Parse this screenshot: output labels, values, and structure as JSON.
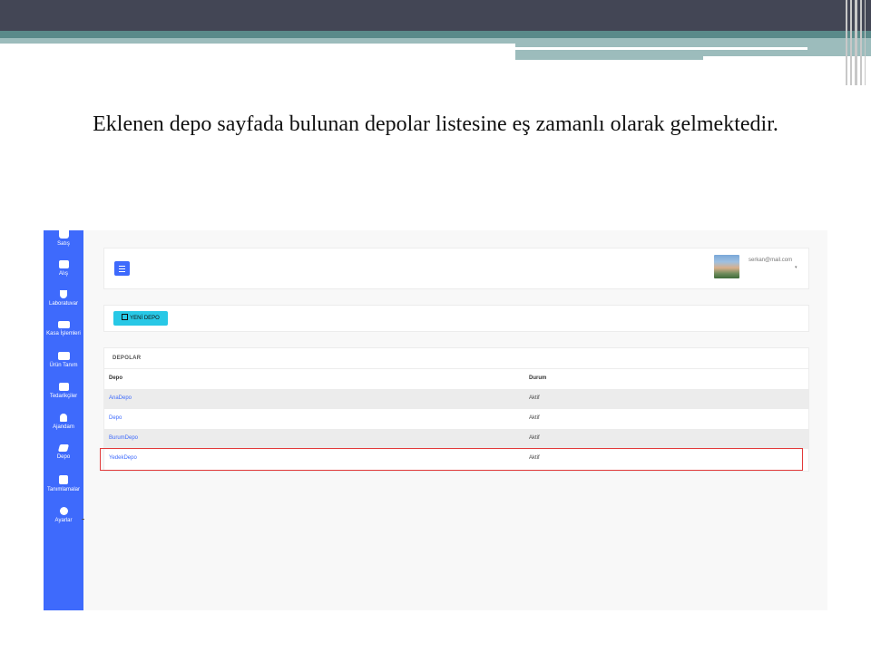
{
  "slide": {
    "text": "Eklenen depo sayfada bulunan depolar listesine eş zamanlı olarak gelmektedir."
  },
  "sidebar": {
    "items": [
      {
        "label": "Satış",
        "icon": "basket-icon"
      },
      {
        "label": "Alış",
        "icon": "truck-icon"
      },
      {
        "label": "Laboratuvar",
        "icon": "flask-icon"
      },
      {
        "label": "Kasa İşlemleri",
        "icon": "money-icon"
      },
      {
        "label": "Ürün Tanım",
        "icon": "people-carry-icon"
      },
      {
        "label": "Tedarikçiler",
        "icon": "truck-icon"
      },
      {
        "label": "Ajandam",
        "icon": "bell-icon"
      },
      {
        "label": "Depo",
        "icon": "dropbox-icon"
      },
      {
        "label": "Tanımlamalar",
        "icon": "plus-square-icon"
      },
      {
        "label": "Ayarlar",
        "icon": "gear-icon"
      }
    ]
  },
  "header": {
    "user_email": "serkan@mail.com",
    "caret": "▾"
  },
  "actions": {
    "new_depot_label": "YENİ DEPO"
  },
  "table": {
    "title": "DEPOLAR",
    "columns": [
      "Depo",
      "Durum"
    ],
    "rows": [
      {
        "name": "AnaDepo",
        "status": "Aktif"
      },
      {
        "name": "Depo",
        "status": "Aktif"
      },
      {
        "name": "BurumDepo",
        "status": "Aktif"
      },
      {
        "name": "YedekDepo",
        "status": "Aktif"
      }
    ]
  },
  "colors": {
    "primary": "#3e6afc",
    "info_button": "#28c8e6",
    "highlight": "#e23a3a"
  }
}
